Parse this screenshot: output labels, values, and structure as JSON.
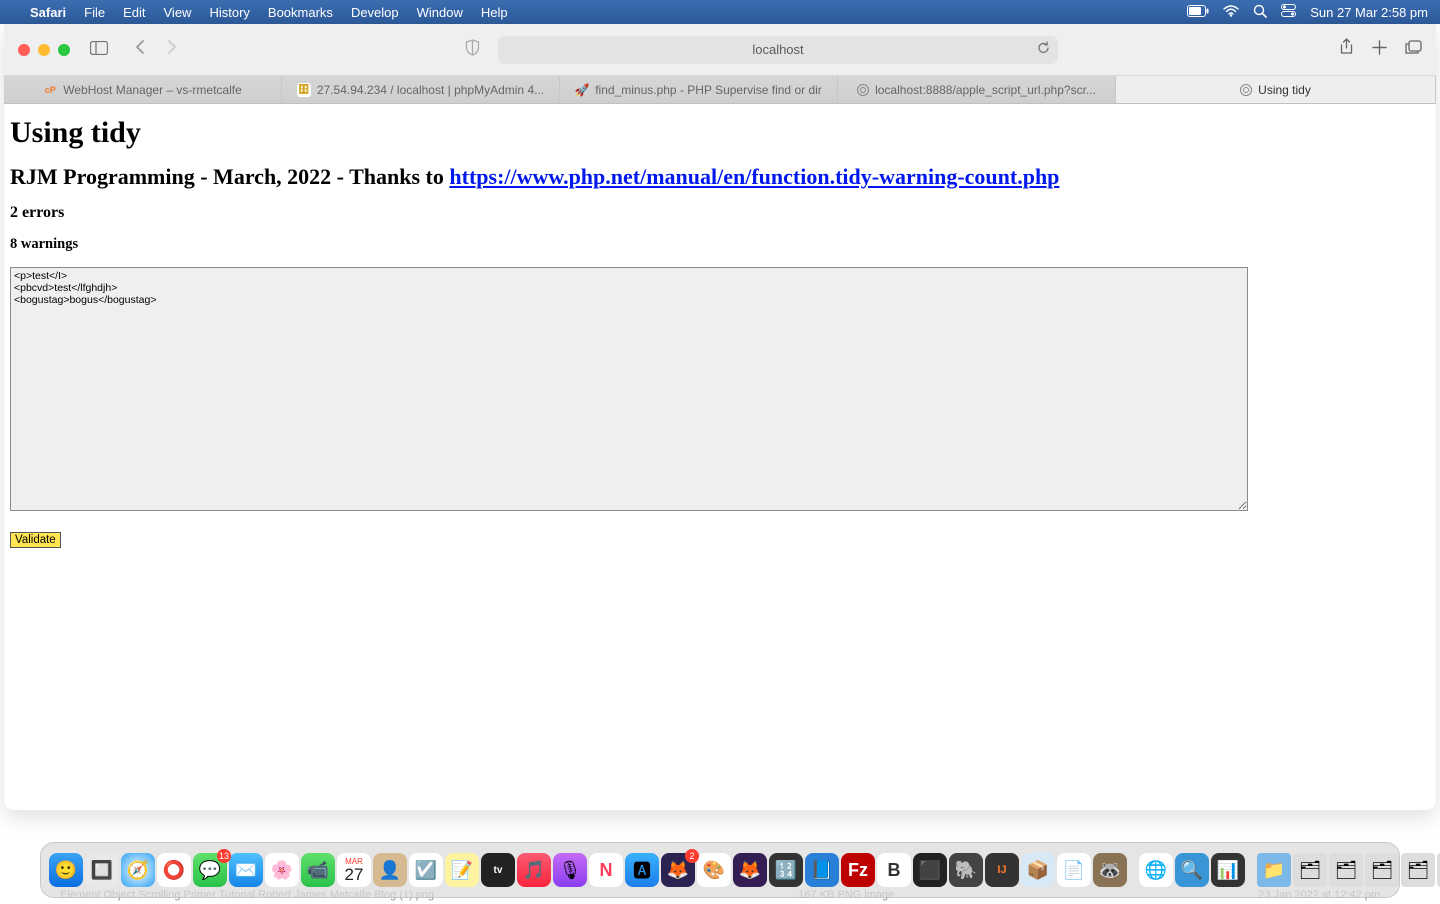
{
  "menubar": {
    "app": "Safari",
    "items": [
      "File",
      "Edit",
      "View",
      "History",
      "Bookmarks",
      "Develop",
      "Window",
      "Help"
    ],
    "datetime": "Sun 27 Mar  2:58 pm"
  },
  "toolbar": {
    "url": "localhost"
  },
  "tabs": [
    {
      "label": "WebHost Manager – vs-rmetcalfe",
      "icon": "cp"
    },
    {
      "label": "27.54.94.234 / localhost | phpMyAdmin 4...",
      "icon": "pma"
    },
    {
      "label": "find_minus.php - PHP Supervise find or dir",
      "icon": "rocket"
    },
    {
      "label": "localhost:8888/apple_script_url.php?scr...",
      "icon": "globe"
    },
    {
      "label": "Using tidy",
      "icon": "globe",
      "active": true
    }
  ],
  "page": {
    "h1": "Using tidy",
    "subtitle_prefix": "RJM Programming - March, 2022 - Thanks to ",
    "subtitle_link": "https://www.php.net/manual/en/function.tidy-warning-count.php",
    "errors": "2 errors",
    "warnings": "8 warnings",
    "textarea": "<p>test</I>\n<pbcvd>test</lfghdjh>\n<bogustag>bogus</bogustag>",
    "button": "Validate"
  },
  "dock": {
    "icons": [
      "finder",
      "launchpad",
      "safari",
      "opera",
      "messages-badge",
      "mail",
      "photos",
      "facetime",
      "calendar",
      "contacts",
      "reminders",
      "notes",
      "tv",
      "music",
      "podcasts",
      "news",
      "shortcuts",
      "appstore",
      "firefox-badge",
      "firefox",
      "calculator",
      "filezilla-blue",
      "filezilla-red",
      "bbedit",
      "terminal",
      "mamp",
      "intellij",
      "app1",
      "textedit",
      "gimp",
      "sep",
      "chrome",
      "obs",
      "activity",
      "sep",
      "folder1",
      "folder2",
      "folder3",
      "folder4",
      "folder5",
      "trash"
    ]
  },
  "bottom": {
    "left": "Element Object Scrolling Primer Tutorial  Robert James Metcalfe Blog (1).png",
    "mid": "167 KB    PNG image",
    "right": "23 Jan 2022 at 12:42 pm"
  }
}
